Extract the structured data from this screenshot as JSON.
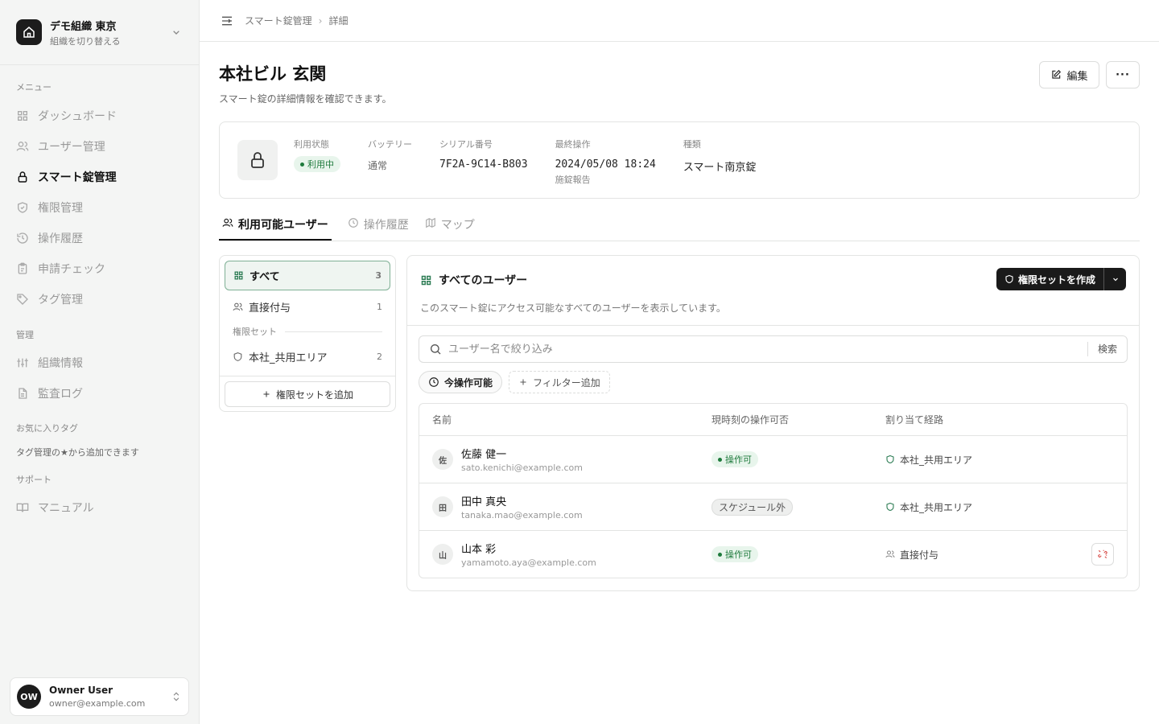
{
  "sidebar": {
    "org_name": "デモ組織 東京",
    "org_sub": "組織を切り替える",
    "menu_label": "メニュー",
    "menu_items": [
      "ダッシュボード",
      "ユーザー管理",
      "スマート錠管理",
      "権限管理",
      "操作履歴",
      "申請チェック",
      "タグ管理"
    ],
    "admin_label": "管理",
    "admin_items": [
      "組織情報",
      "監査ログ"
    ],
    "fav_label": "お気に入りタグ",
    "fav_hint": "タグ管理の★から追加できます",
    "support_label": "サポート",
    "support_items": [
      "マニュアル"
    ],
    "user": {
      "initials": "OW",
      "name": "Owner User",
      "email": "owner@example.com"
    }
  },
  "breadcrumb": [
    "スマート錠管理",
    "詳細"
  ],
  "page": {
    "title": "本社ビル 玄関",
    "subtitle": "スマート錠の詳細情報を確認できます。",
    "edit_label": "編集",
    "more_label": "···"
  },
  "info": {
    "status_label": "利用状態",
    "status_value": "利用中",
    "battery_label": "バッテリー",
    "battery_value": "通常",
    "serial_label": "シリアル番号",
    "serial_value": "7F2A-9C14-B803",
    "last_label": "最終操作",
    "last_value": "2024/05/08 18:24",
    "last_note": "施錠報告",
    "type_label": "種類",
    "type_value": "スマート南京錠"
  },
  "tabs": [
    "利用可能ユーザー",
    "操作履歴",
    "マップ"
  ],
  "left_panel": {
    "all_label": "すべて",
    "all_count": "3",
    "direct_label": "直接付与",
    "direct_count": "1",
    "section_label": "権限セット",
    "set_label": "本社_共用エリア",
    "set_count": "2",
    "add_label": "権限セットを追加"
  },
  "right_panel": {
    "title": "すべてのユーザー",
    "desc": "このスマート錠にアクセス可能なすべてのユーザーを表示しています。",
    "create_label": "権限セットを作成",
    "search_placeholder": "ユーザー名で絞り込み",
    "search_button": "検索",
    "filter_active": "今操作可能",
    "filter_add": "フィルター追加",
    "columns": [
      "名前",
      "現時刻の操作可否",
      "割り当て経路"
    ],
    "rows": [
      {
        "initial": "佐",
        "name": "佐藤 健一",
        "email": "sato.kenichi@example.com",
        "status": "操作可",
        "route": "本社_共用エリア"
      },
      {
        "initial": "田",
        "name": "田中 真央",
        "email": "tanaka.mao@example.com",
        "status": "スケジュール外",
        "route": "本社_共用エリア"
      },
      {
        "initial": "山",
        "name": "山本 彩",
        "email": "yamamoto.aya@example.com",
        "status": "操作可",
        "route": "直接付与"
      }
    ]
  },
  "colors": {
    "accent_green": "#1e7a3c",
    "dark": "#1a1a1a",
    "danger": "#d9534f"
  }
}
